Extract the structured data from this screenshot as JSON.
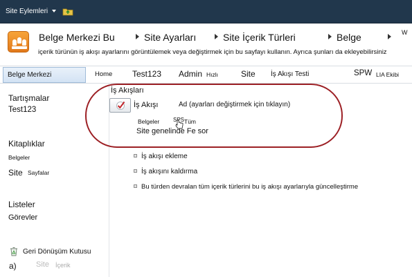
{
  "topbar": {
    "site_actions": "Site Eylemleri",
    "folder_icon": "folder-up-icon"
  },
  "title_area": {
    "logo_icon": "document-center-icon",
    "breadcrumb": [
      "Belge Merkezi Bu",
      "Site Ayarları",
      "Site  İçerik Türleri",
      "Belge",
      "W"
    ],
    "description": "içerik türünün iş akışı ayarlarını görüntülemek veya değiştirmek için bu sayfayı kullanın. Ayrıca şunları da ekleyebilirsiniz"
  },
  "navbar": {
    "items": [
      "Belge Merkezi",
      "Home",
      "Test123",
      "Admin",
      "Hızlı",
      "Site",
      "İş Akışı Testi",
      "SPW",
      "LIA Ekibi"
    ]
  },
  "left_nav": {
    "discussions_header": "Tartışmalar",
    "discussions_item": "Test123",
    "libraries_header": "Kitaplıklar",
    "libraries_documents": "Belgeler",
    "libraries_site": "Site",
    "libraries_pages": "Sayfalar",
    "lists_header": "Listeler",
    "lists_tasks": "Görevler",
    "recycle_bin": "Geri Dönüşüm Kutusu",
    "recycle_icon": "recycle-bin-icon",
    "site_content_a": "Site",
    "site_content_b": "İçerik"
  },
  "main": {
    "section_title": "İş Akışları",
    "workflow_icon": "workflow-check-icon",
    "workflow_label": "İş Akışı",
    "workflow_name_header": "Ad (ayarları değiştirmek için tıklayın)",
    "documents_label": "Belgeler",
    "sps_label": "SPS",
    "all_label": "Tüm",
    "site_wide_label": "Site genelinde Fe sor",
    "links": [
      "İş akışı ekleme",
      "İş akışını kaldırma",
      "Bu türden devralan tüm içerik türlerini bu iş akışı ayarlarıyla güncelleştirme"
    ]
  },
  "annotation": {
    "label": "a)",
    "highlight_color": "#9c1f24"
  }
}
